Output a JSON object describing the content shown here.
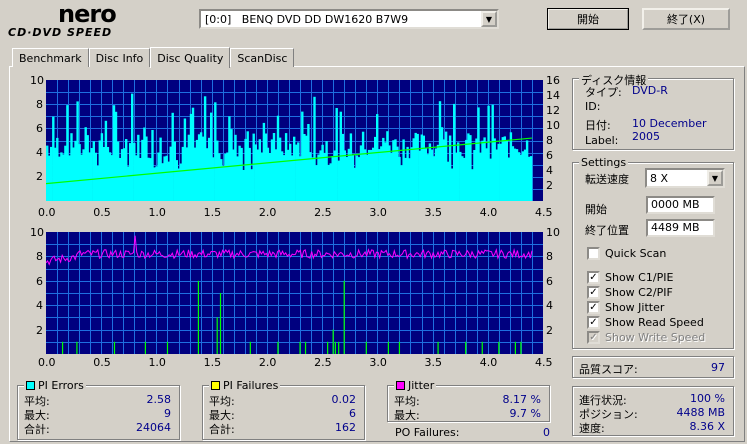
{
  "header": {
    "logo_main": "nero",
    "logo_sub": "CD·DVD SPEED",
    "drive": "[0:0]   BENQ DVD DD DW1620 B7W9",
    "start_label": "開始",
    "exit_label": "終了(X)"
  },
  "tabs": [
    "Benchmark",
    "Disc Info",
    "Disc Quality",
    "ScanDisc"
  ],
  "active_tab": "Disc Quality",
  "chart_data": [
    {
      "type": "bar",
      "name": "PI Errors",
      "x_ticks": [
        "0.0",
        "0.5",
        "1.0",
        "1.5",
        "2.0",
        "2.5",
        "3.0",
        "3.5",
        "4.0",
        "4.5"
      ],
      "y_left_ticks": [
        "10",
        "8",
        "6",
        "4",
        "2"
      ],
      "y_right_ticks": [
        "16",
        "14",
        "12",
        "10",
        "8",
        "6",
        "4",
        "2"
      ],
      "xlim": [
        0,
        4.5
      ],
      "ylim_left": [
        0,
        10
      ],
      "ylim_right": [
        0,
        16
      ],
      "bar_color": "#00ffff",
      "speed_line_color": "#00ff00",
      "speed_line": [
        [
          0,
          2.3
        ],
        [
          4.4,
          5.2
        ]
      ],
      "pi_average": 2.58,
      "pi_max": 9
    },
    {
      "type": "line",
      "name": "PI Failures / Jitter",
      "x_ticks": [
        "0.0",
        "0.5",
        "1.0",
        "1.5",
        "2.0",
        "2.5",
        "3.0",
        "3.5",
        "4.0",
        "4.5"
      ],
      "y_left_ticks": [
        "10",
        "8",
        "6",
        "4",
        "2"
      ],
      "y_right_ticks": [
        "10",
        "8",
        "6",
        "4",
        "2"
      ],
      "xlim": [
        0,
        4.5
      ],
      "ylim": [
        0,
        10
      ],
      "jitter_color": "#ff00ff",
      "pif_color": "#00ff00",
      "jitter_level": 8.2,
      "pif_spikes": [
        [
          0.15,
          1
        ],
        [
          0.28,
          1
        ],
        [
          0.62,
          1
        ],
        [
          0.9,
          1
        ],
        [
          1.1,
          1
        ],
        [
          1.38,
          6
        ],
        [
          1.55,
          3
        ],
        [
          1.58,
          5
        ],
        [
          1.85,
          1
        ],
        [
          2.1,
          1
        ],
        [
          2.3,
          1
        ],
        [
          2.35,
          1
        ],
        [
          2.55,
          1
        ],
        [
          2.6,
          2
        ],
        [
          2.65,
          1
        ],
        [
          2.62,
          1
        ],
        [
          2.7,
          6
        ],
        [
          2.9,
          1
        ],
        [
          3.1,
          1
        ],
        [
          3.2,
          1
        ],
        [
          3.55,
          1
        ],
        [
          3.8,
          1
        ],
        [
          3.95,
          1
        ],
        [
          4.1,
          1
        ],
        [
          4.25,
          1
        ],
        [
          4.3,
          1
        ]
      ]
    }
  ],
  "pi_errors": {
    "label": "PI Errors",
    "color": "#00ffff",
    "avg_label": "平均:",
    "avg": "2.58",
    "max_label": "最大:",
    "max": "9",
    "total_label": "合計:",
    "total": "24064"
  },
  "pi_failures": {
    "label": "PI Failures",
    "color": "#ffff00",
    "avg_label": "平均:",
    "avg": "0.02",
    "max_label": "最大:",
    "max": "6",
    "total_label": "合計:",
    "total": "162"
  },
  "jitter": {
    "label": "Jitter",
    "color": "#ff00ff",
    "avg_label": "平均:",
    "avg": "8.17 %",
    "max_label": "最大:",
    "max": "9.7 %"
  },
  "po_failures": {
    "label": "PO Failures:",
    "value": "0"
  },
  "disc_info": {
    "title": "ディスク情報",
    "type_label": "タイプ:",
    "type": "DVD-R",
    "id_label": "ID:",
    "id": "",
    "date_label": "日付:",
    "date": "10 December 2005",
    "label_label": "Label:",
    "label": ""
  },
  "settings": {
    "title": "Settings",
    "speed_label": "転送速度",
    "speed": "8 X",
    "start_label": "開始",
    "start": "0000 MB",
    "end_label": "終了位置",
    "end": "4489 MB",
    "quick_scan": "Quick Scan",
    "show_c1": "Show C1/PIE",
    "show_c2": "Show C2/PIF",
    "show_jitter": "Show Jitter",
    "show_read": "Show Read Speed",
    "show_write": "Show Write Speed"
  },
  "quality": {
    "label": "品質スコア:",
    "value": "97"
  },
  "progress": {
    "status_label": "進行状況:",
    "status": "100 %",
    "position_label": "ポジション:",
    "position": "4488 MB",
    "speed_label": "速度:",
    "speed": "8.36 X"
  }
}
